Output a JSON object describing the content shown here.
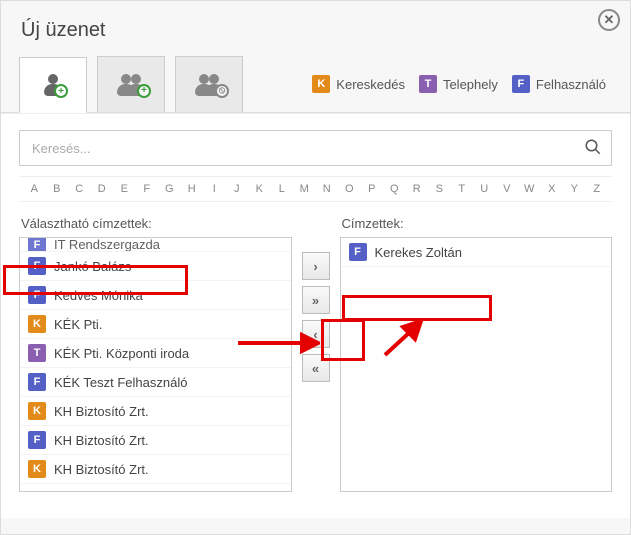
{
  "dialog": {
    "title": "Új üzenet"
  },
  "legend": {
    "k_letter": "K",
    "k_label": "Kereskedés",
    "t_letter": "T",
    "t_label": "Telephely",
    "f_letter": "F",
    "f_label": "Felhasználó"
  },
  "search": {
    "placeholder": "Keresés..."
  },
  "alphabet": [
    "A",
    "B",
    "C",
    "D",
    "E",
    "F",
    "G",
    "H",
    "I",
    "J",
    "K",
    "L",
    "M",
    "N",
    "O",
    "P",
    "Q",
    "R",
    "S",
    "T",
    "U",
    "V",
    "W",
    "X",
    "Y",
    "Z"
  ],
  "left": {
    "label": "Választható címzettek:",
    "items": [
      {
        "tag": "F",
        "name": "IT Rendszergazda"
      },
      {
        "tag": "F",
        "name": "Jankó Balázs"
      },
      {
        "tag": "F",
        "name": "Kedves Mónika"
      },
      {
        "tag": "K",
        "name": "KÉK Pti."
      },
      {
        "tag": "T",
        "name": "KÉK Pti. Központi iroda"
      },
      {
        "tag": "F",
        "name": "KÉK Teszt Felhasználó"
      },
      {
        "tag": "K",
        "name": "KH Biztosító Zrt."
      },
      {
        "tag": "F",
        "name": "KH Biztosító Zrt."
      },
      {
        "tag": "K",
        "name": "KH Biztosító Zrt."
      }
    ]
  },
  "right": {
    "label": "Címzettek:",
    "items": [
      {
        "tag": "F",
        "name": "Kerekes Zoltán"
      }
    ]
  },
  "move": {
    "add": "›",
    "addAll": "»",
    "remove": "‹",
    "removeAll": "«"
  }
}
